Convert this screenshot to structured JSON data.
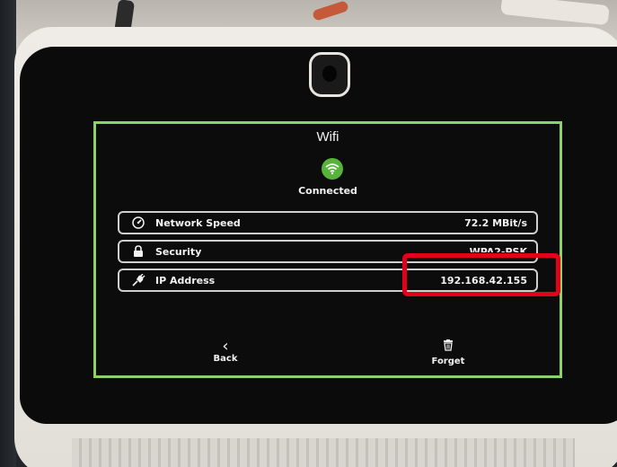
{
  "screen": {
    "title": "Wifi",
    "status": "Connected",
    "rows": [
      {
        "icon": "speedometer-icon",
        "label": "Network Speed",
        "value": "72.2 MBit/s"
      },
      {
        "icon": "lock-icon",
        "label": "Security",
        "value": "WPA2-PSK"
      },
      {
        "icon": "plug-icon",
        "label": "IP Address",
        "value": "192.168.42.155"
      }
    ],
    "back_label": "Back",
    "forget_label": "Forget"
  },
  "colors": {
    "accent_border": "#8fd06b",
    "wifi_badge": "#58b33a",
    "highlight": "#e3001b"
  }
}
